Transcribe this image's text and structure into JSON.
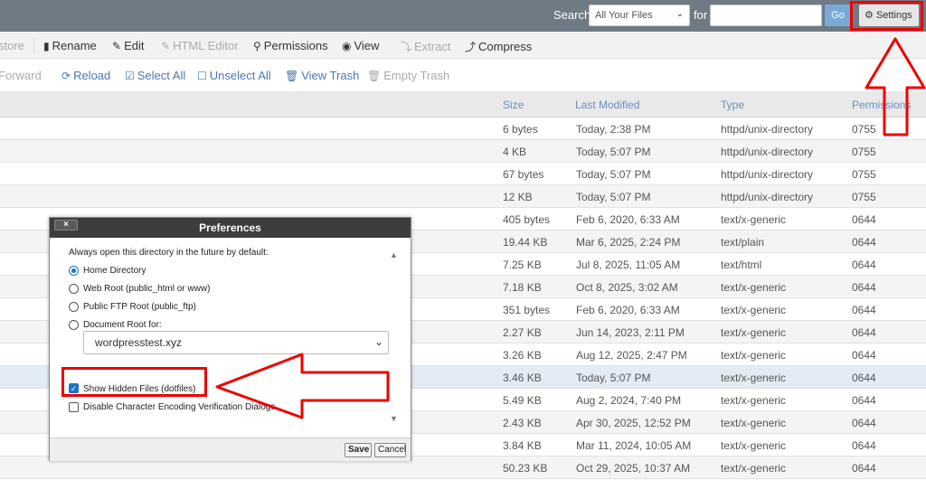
{
  "topbar": {
    "search_label": "Search",
    "search_scope": "All Your Files",
    "for_label": "for",
    "search_placeholder": "",
    "go_label": "Go",
    "settings_label": "Settings"
  },
  "toolbar": {
    "restore": "store",
    "rename": "Rename",
    "edit": "Edit",
    "html_editor": "HTML Editor",
    "permissions": "Permissions",
    "view": "View",
    "extract": "Extract",
    "compress": "Compress"
  },
  "toolbar2": {
    "forward": "Forward",
    "reload": "Reload",
    "select_all": "Select All",
    "unselect_all": "Unselect All",
    "view_trash": "View Trash",
    "empty_trash": "Empty Trash"
  },
  "table": {
    "headers": {
      "size": "Size",
      "modified": "Last Modified",
      "type": "Type",
      "perms": "Permissions"
    },
    "rows": [
      {
        "size": "6 bytes",
        "modified": "Today, 2:38 PM",
        "type": "httpd/unix-directory",
        "perms": "0755"
      },
      {
        "size": "4 KB",
        "modified": "Today, 5:07 PM",
        "type": "httpd/unix-directory",
        "perms": "0755"
      },
      {
        "size": "67 bytes",
        "modified": "Today, 5:07 PM",
        "type": "httpd/unix-directory",
        "perms": "0755"
      },
      {
        "size": "12 KB",
        "modified": "Today, 5:07 PM",
        "type": "httpd/unix-directory",
        "perms": "0755"
      },
      {
        "size": "405 bytes",
        "modified": "Feb 6, 2020, 6:33 AM",
        "type": "text/x-generic",
        "perms": "0644"
      },
      {
        "size": "19.44 KB",
        "modified": "Mar 6, 2025, 2:24 PM",
        "type": "text/plain",
        "perms": "0644"
      },
      {
        "size": "7.25 KB",
        "modified": "Jul 8, 2025, 11:05 AM",
        "type": "text/html",
        "perms": "0644"
      },
      {
        "size": "7.18 KB",
        "modified": "Oct 8, 2025, 3:02 AM",
        "type": "text/x-generic",
        "perms": "0644"
      },
      {
        "size": "351 bytes",
        "modified": "Feb 6, 2020, 6:33 AM",
        "type": "text/x-generic",
        "perms": "0644"
      },
      {
        "size": "2.27 KB",
        "modified": "Jun 14, 2023, 2:11 PM",
        "type": "text/x-generic",
        "perms": "0644"
      },
      {
        "size": "3.26 KB",
        "modified": "Aug 12, 2025, 2:47 PM",
        "type": "text/x-generic",
        "perms": "0644"
      },
      {
        "size": "3.46 KB",
        "modified": "Today, 5:07 PM",
        "type": "text/x-generic",
        "perms": "0644"
      },
      {
        "size": "5.49 KB",
        "modified": "Aug 2, 2024, 7:40 PM",
        "type": "text/x-generic",
        "perms": "0644"
      },
      {
        "size": "2.43 KB",
        "modified": "Apr 30, 2025, 12:52 PM",
        "type": "text/x-generic",
        "perms": "0644"
      },
      {
        "size": "3.84 KB",
        "modified": "Mar 11, 2024, 10:05 AM",
        "type": "text/x-generic",
        "perms": "0644"
      },
      {
        "size": "50.23 KB",
        "modified": "Oct 29, 2025, 10:37 AM",
        "type": "text/x-generic",
        "perms": "0644"
      }
    ]
  },
  "dialog": {
    "title": "Preferences",
    "close": "×",
    "intro": "Always open this directory in the future by default:",
    "options": {
      "home": "Home Directory",
      "webroot": "Web Root (public_html or www)",
      "ftp": "Public FTP Root (public_ftp)",
      "docroot": "Document Root for:"
    },
    "docroot_value": "wordpresstest.xyz",
    "show_hidden": "Show Hidden Files (dotfiles)",
    "disable_encoding": "Disable Character Encoding Verification Dialogs",
    "save": "Save",
    "cancel": "Cancel"
  },
  "colors": {
    "topbar": "#707a85",
    "link": "#4878b8",
    "highlight": "#e00000",
    "accent": "#1a73c8"
  }
}
